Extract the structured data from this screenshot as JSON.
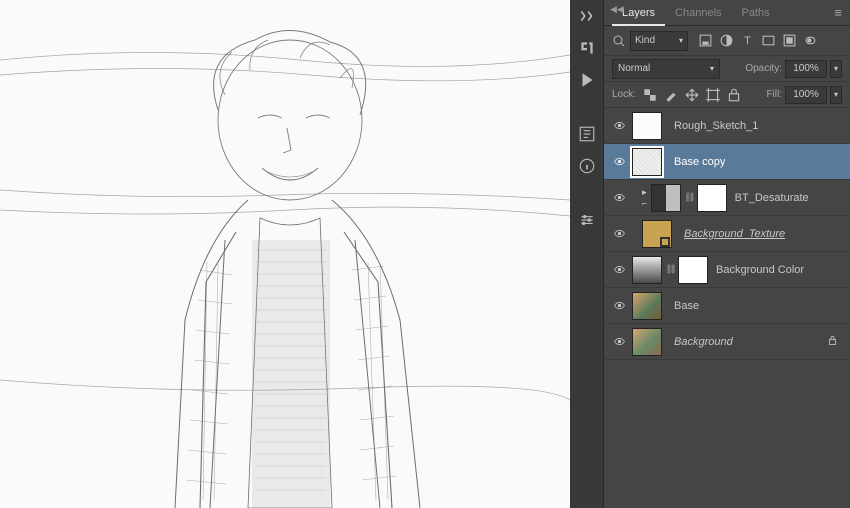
{
  "tabs": {
    "layers": "Layers",
    "channels": "Channels",
    "paths": "Paths"
  },
  "filter": {
    "kind_label": "Kind"
  },
  "blend": {
    "mode": "Normal",
    "opacity_label": "Opacity:",
    "opacity_value": "100%"
  },
  "lock": {
    "label": "Lock:",
    "fill_label": "Fill:",
    "fill_value": "100%"
  },
  "layers": [
    {
      "name": "Rough_Sketch_1"
    },
    {
      "name": "Base copy"
    },
    {
      "name": "BT_Desaturate"
    },
    {
      "name": "Background_Texture "
    },
    {
      "name": "Background Color"
    },
    {
      "name": "Base"
    },
    {
      "name": "Background"
    }
  ]
}
